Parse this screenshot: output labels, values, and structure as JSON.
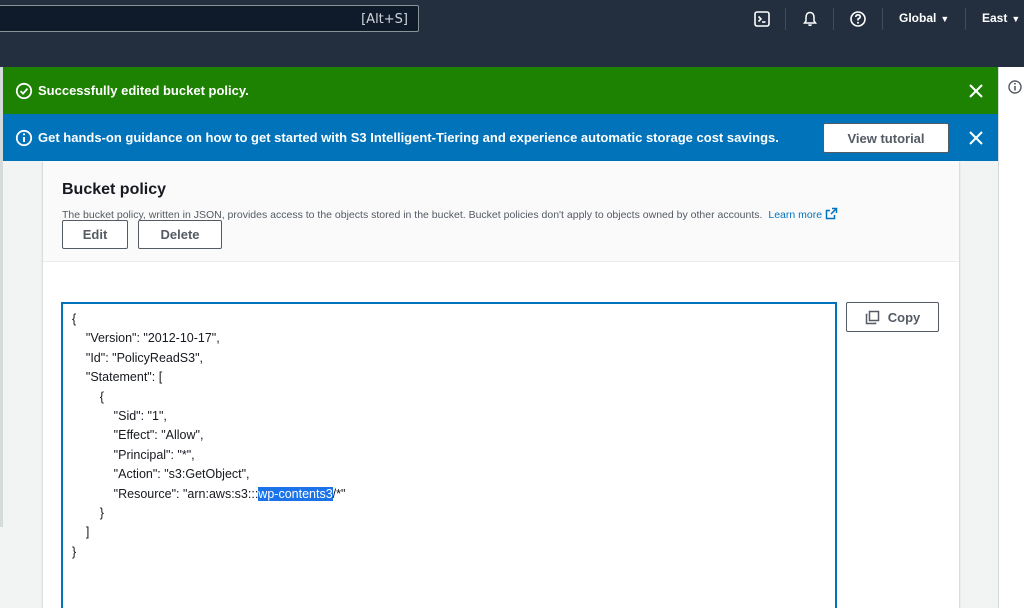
{
  "topbar": {
    "search_shortcut": "[Alt+S]",
    "region_global": "Global",
    "region_east": "East"
  },
  "flash_success": {
    "message": "Successfully edited bucket policy."
  },
  "flash_info": {
    "message": "Get hands-on guidance on how to get started with S3 Intelligent-Tiering and experience automatic storage cost savings.",
    "button_label": "View tutorial"
  },
  "bucket_policy": {
    "title": "Bucket policy",
    "description": "The bucket policy, written in JSON, provides access to the objects stored in the bucket. Bucket policies don't apply to objects owned by other accounts.",
    "learn_more": "Learn more",
    "edit_label": "Edit",
    "delete_label": "Delete",
    "copy_label": "Copy"
  },
  "policy": {
    "line1": "{",
    "line2": "    \"Version\": \"2012-10-17\",",
    "line3": "    \"Id\": \"PolicyReadS3\",",
    "line4": "    \"Statement\": [",
    "line5": "        {",
    "line6": "            \"Sid\": \"1\",",
    "line7": "            \"Effect\": \"Allow\",",
    "line8": "            \"Principal\": \"*\",",
    "line9": "            \"Action\": \"s3:GetObject\",",
    "resource_prefix": "            \"Resource\": \"arn:aws:s3:::",
    "resource_selected": "wp-contents3",
    "resource_suffix": "/*\"",
    "line11": "        }",
    "line12": "    ]",
    "line13": "}"
  },
  "colors": {
    "success": "#1d8102",
    "info": "#0073bb",
    "nav": "#232f3e"
  }
}
